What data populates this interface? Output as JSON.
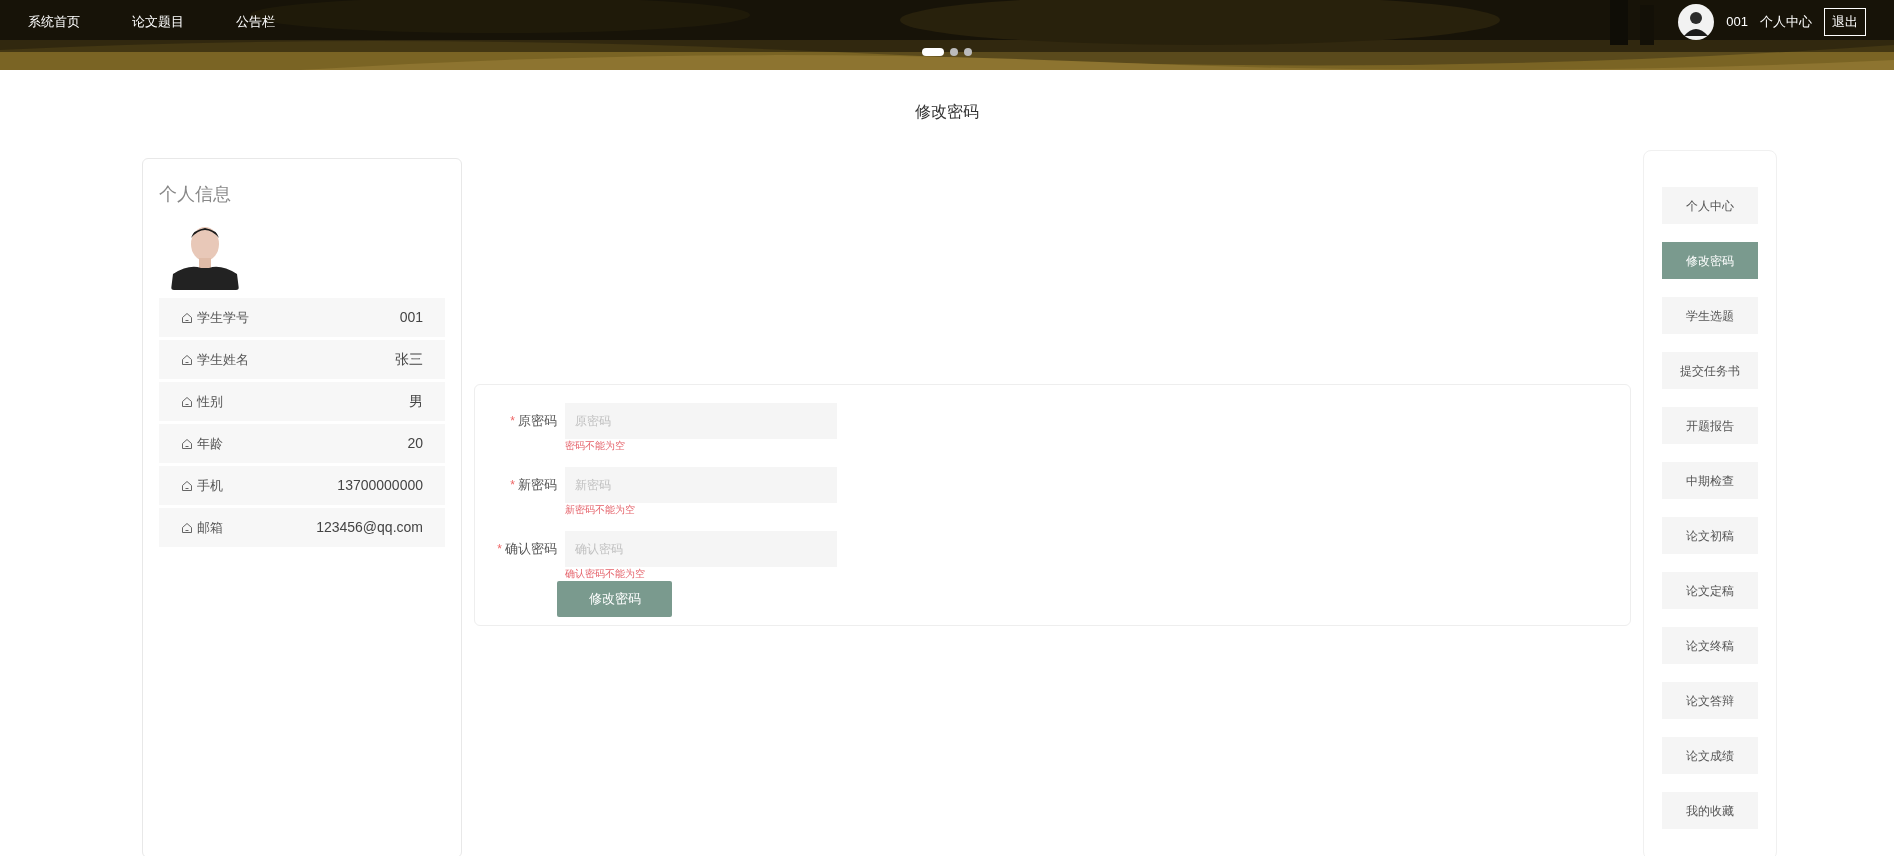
{
  "nav": {
    "links": [
      {
        "label": "系统首页"
      },
      {
        "label": "论文题目"
      },
      {
        "label": "公告栏"
      }
    ],
    "carousel_dots": [
      {
        "selected": true
      },
      {
        "selected": false
      },
      {
        "selected": false
      }
    ],
    "user": {
      "name": "001",
      "center": "个人中心",
      "logout": "退出"
    }
  },
  "page_title": "修改密码",
  "profile": {
    "title": "个人信息",
    "rows": [
      {
        "label": "学生学号",
        "value": "001"
      },
      {
        "label": "学生姓名",
        "value": "张三"
      },
      {
        "label": "性别",
        "value": "男"
      },
      {
        "label": "年龄",
        "value": "20"
      },
      {
        "label": "手机",
        "value": "13700000000"
      },
      {
        "label": "邮箱",
        "value": "123456@qq.com"
      }
    ]
  },
  "form": {
    "fields": [
      {
        "required_mark": "*",
        "label": "原密码",
        "placeholder": "原密码",
        "error": "密码不能为空"
      },
      {
        "required_mark": "*",
        "label": "新密码",
        "placeholder": "新密码",
        "error": "新密码不能为空"
      },
      {
        "required_mark": "*",
        "label": "确认密码",
        "placeholder": "确认密码",
        "error": "确认密码不能为空"
      }
    ],
    "submit": "修改密码"
  },
  "menu": {
    "items": [
      {
        "label": "个人中心",
        "selected": false
      },
      {
        "label": "修改密码",
        "selected": true
      },
      {
        "label": "学生选题",
        "selected": false
      },
      {
        "label": "提交任务书",
        "selected": false
      },
      {
        "label": "开题报告",
        "selected": false
      },
      {
        "label": "中期检查",
        "selected": false
      },
      {
        "label": "论文初稿",
        "selected": false
      },
      {
        "label": "论文定稿",
        "selected": false
      },
      {
        "label": "论文终稿",
        "selected": false
      },
      {
        "label": "论文答辩",
        "selected": false
      },
      {
        "label": "论文成绩",
        "selected": false
      },
      {
        "label": "我的收藏",
        "selected": false
      }
    ]
  }
}
